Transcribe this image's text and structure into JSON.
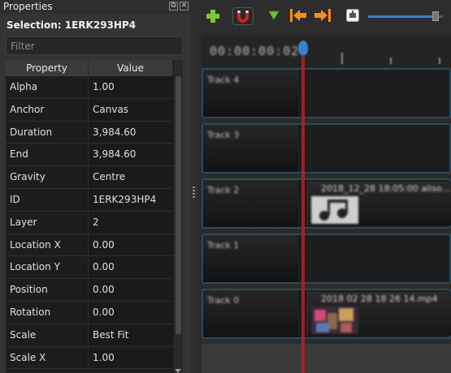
{
  "panel": {
    "title": "Properties",
    "selection_label": "Selection: 1ERK293HP4",
    "filter_placeholder": "Filter",
    "columns": [
      "Property",
      "Value"
    ],
    "rows": [
      {
        "property": "Alpha",
        "value": "1.00"
      },
      {
        "property": "Anchor",
        "value": "Canvas"
      },
      {
        "property": "Duration",
        "value": "3,984.60"
      },
      {
        "property": "End",
        "value": "3,984.60"
      },
      {
        "property": "Gravity",
        "value": "Centre"
      },
      {
        "property": "ID",
        "value": "1ERK293HP4"
      },
      {
        "property": "Layer",
        "value": "2"
      },
      {
        "property": "Location X",
        "value": "0.00"
      },
      {
        "property": "Location Y",
        "value": "0.00"
      },
      {
        "property": "Position",
        "value": "0.00"
      },
      {
        "property": "Rotation",
        "value": "0.00"
      },
      {
        "property": "Scale",
        "value": "Best Fit"
      },
      {
        "property": "Scale X",
        "value": "1.00"
      }
    ]
  },
  "toolbar": {
    "icons": [
      "add-track-icon",
      "snap-magnet-icon",
      "add-marker-icon",
      "previous-marker-icon",
      "next-marker-icon",
      "center-playhead-icon"
    ],
    "zoom_level": 0.9
  },
  "timeline": {
    "timecode": "00:00:00:02",
    "tracks": [
      {
        "name": "Track 4",
        "clip": null
      },
      {
        "name": "Track 3",
        "clip": null
      },
      {
        "name": "Track 2",
        "clip": "2018_12_28 18:05:00 aliso..."
      },
      {
        "name": "Track 1",
        "clip": null
      },
      {
        "name": "Track 0",
        "clip": "2018 02 28 18 26 14.mp4"
      }
    ]
  },
  "colors": {
    "accent": "#3b7fd1",
    "playhead": "#a52626",
    "add": "#7fc53a",
    "marker": "#ff8a1e"
  }
}
